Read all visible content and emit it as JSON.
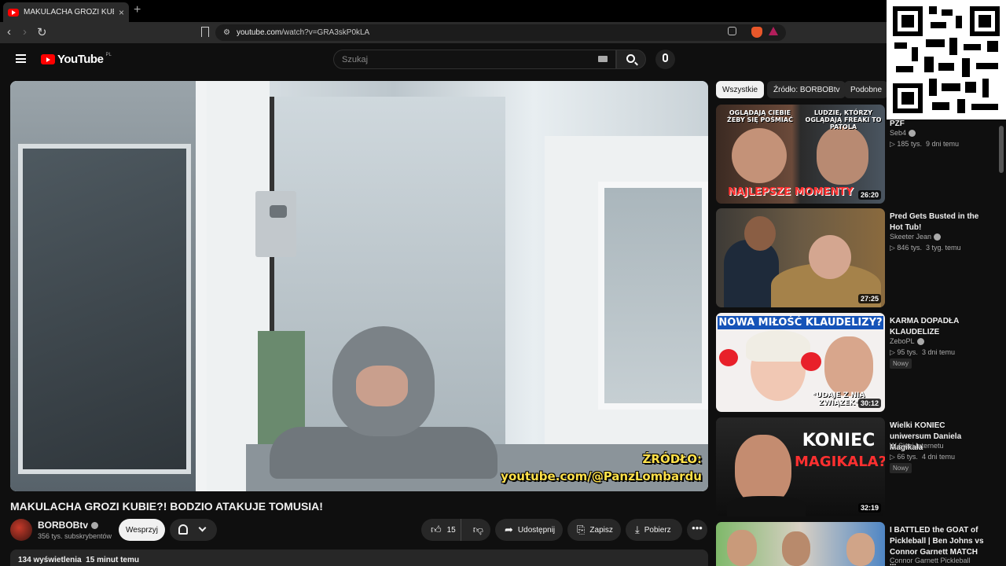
{
  "browser": {
    "tab_title": "MAKULACHA GROZI KUBIE?!",
    "tab_close": "×",
    "new_tab": "+",
    "url_host": "youtube.com",
    "url_path": "/watch?v=GRA3skP0kLA",
    "nav_back": "‹",
    "nav_forward": "›",
    "nav_reload": "↻"
  },
  "header": {
    "logo_text": "YouTube",
    "region": "PL",
    "search_placeholder": "Szukaj"
  },
  "video": {
    "overlay_line1": "ŹRÓDŁO:",
    "overlay_line2": "youtube.com/@PanzLombardu",
    "title": "MAKULACHA GROZI KUBIE?! BODZIO ATAKUJE TOMUSIA!",
    "channel_name": "BORBOBtv",
    "subscribers": "356 tys. subskrybentów",
    "support_label": "Wesprzyj",
    "likes": "15",
    "share_label": "Udostępnij",
    "save_label": "Zapisz",
    "download_label": "Pobierz",
    "views": "134 wyświetlenia",
    "uploaded": "15 minut temu"
  },
  "chips": [
    {
      "label": "Wszystkie"
    },
    {
      "label": "Źródło: BORBOBtv"
    },
    {
      "label": "Podobne"
    }
  ],
  "recommendations": [
    {
      "title": "NAJLEPSZE MOMENTY PZF",
      "channel": "Seb4",
      "views": "185 tys.",
      "age": "9 dni temu",
      "duration": "26:20",
      "badge": "",
      "thumb_top": "OGLĄDAJĄ CIEBIE ŻEBY SIĘ POŚMIAĆ",
      "thumb_top2": "LUDZIE, KTÓRZY OGLĄDAJĄ FREAKI TO PATOLA",
      "thumb_bottom": "NAJLEPSZE MOMENTY"
    },
    {
      "title": "Pred Gets Busted in the Hot Tub!",
      "channel": "Skeeter Jean",
      "views": "846 tys.",
      "age": "3 tyg. temu",
      "duration": "27:25",
      "badge": ""
    },
    {
      "title": "KARMA DOPADŁA KLAUDELIZE",
      "channel": "ZeboPL",
      "views": "95 tys.",
      "age": "3 dni temu",
      "duration": "30:12",
      "badge": "Nowy",
      "thumb_top": "NOWA MIŁOŚĆ KLAUDELIZY?",
      "thumb_bottom": "*UDAJE Z NIĄ ZWIĄZEK*"
    },
    {
      "title": "Wielki KONIEC uniwersum Daniela Magikala",
      "channel": "W Sieci Internetu",
      "views": "66 tys.",
      "age": "4 dni temu",
      "duration": "32:19",
      "badge": "Nowy",
      "thumb_top": "KONIEC",
      "thumb_bottom": "MAGIKALA?"
    },
    {
      "title": "I BATTLED the GOAT of Pickleball | Ben Johns vs Connor Garnett MATCH ...",
      "channel": "Connor Garnett Pickleball",
      "views": "",
      "age": "",
      "duration": "",
      "badge": ""
    }
  ],
  "colors": {
    "background": "#0f0f0f",
    "brand_red": "#ff0000",
    "overlay_yellow": "#ffe14a",
    "pill_bg": "#272727"
  }
}
